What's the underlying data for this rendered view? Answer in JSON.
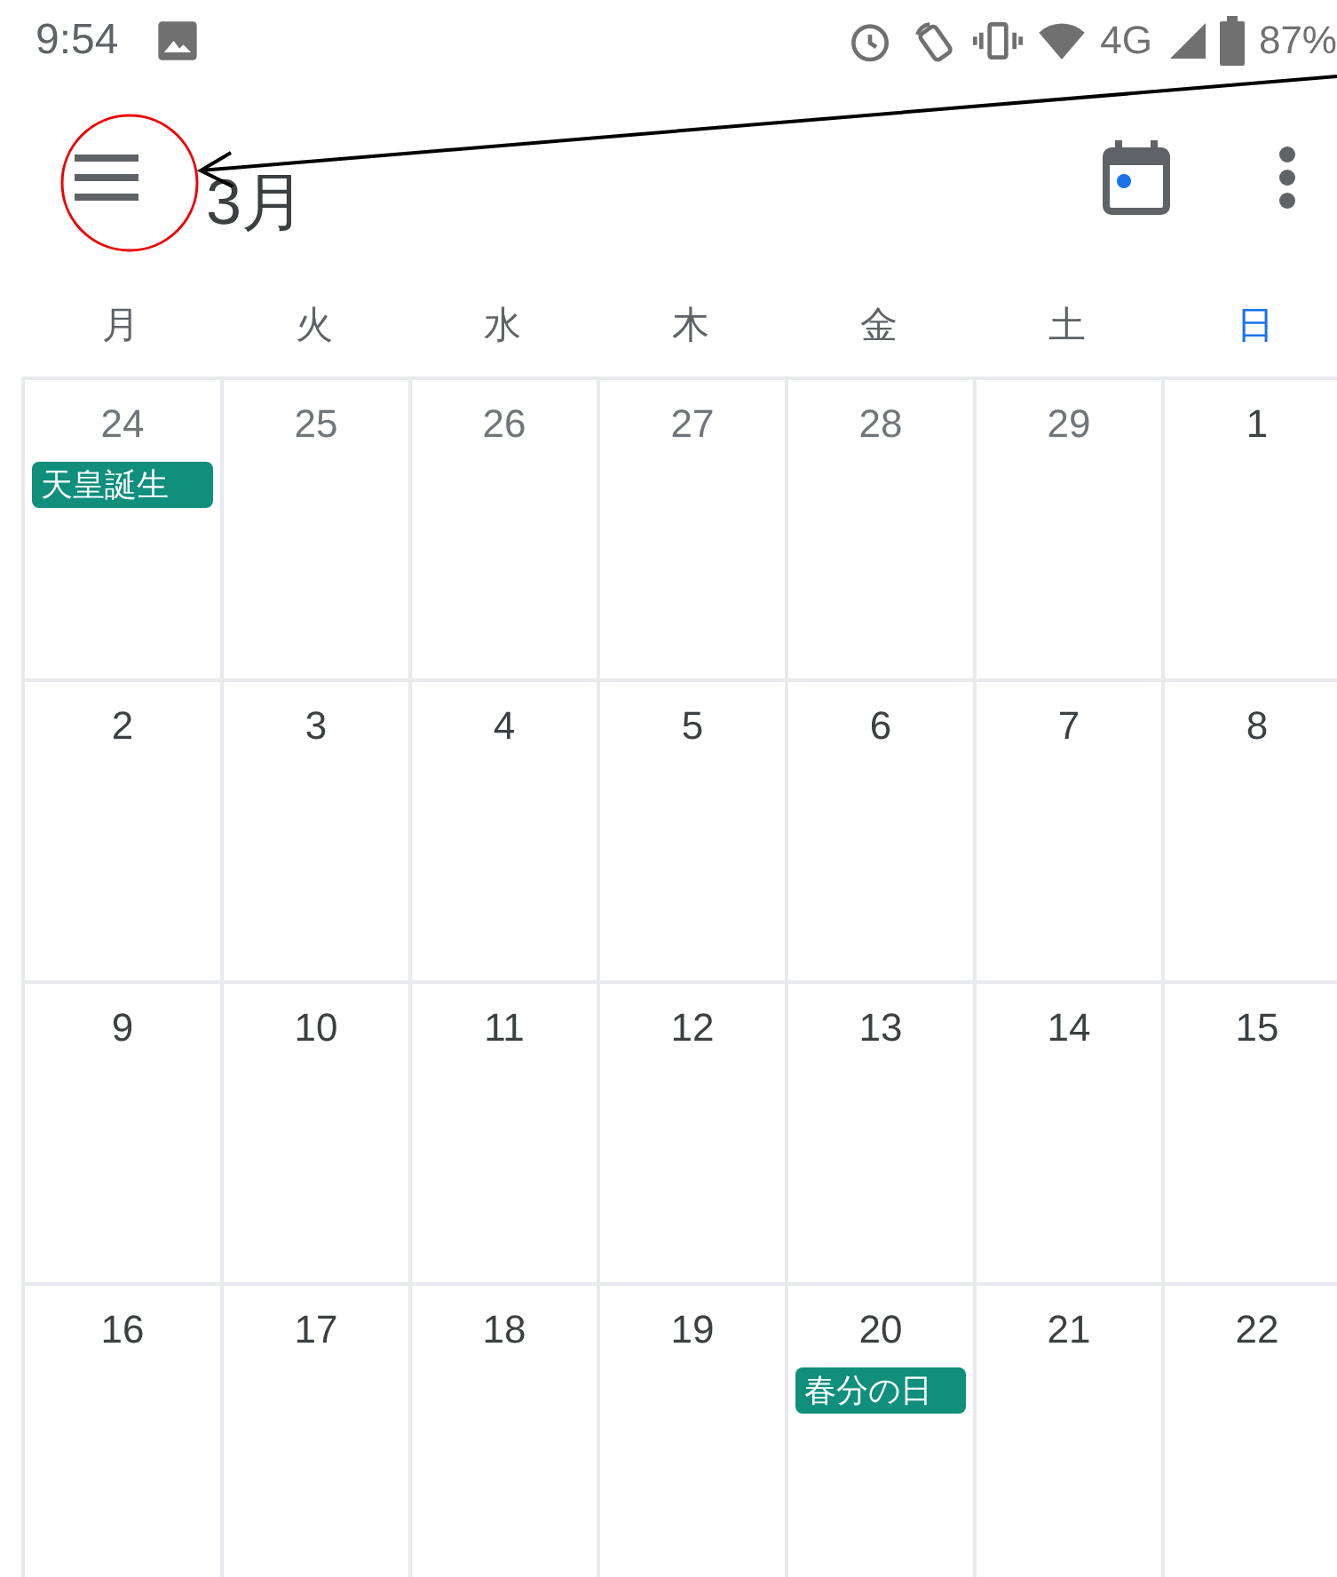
{
  "status_bar": {
    "time": "9:54",
    "network": "4G",
    "battery": "87%"
  },
  "app_bar": {
    "title": "3月"
  },
  "weekdays": [
    {
      "label": "月",
      "today": false
    },
    {
      "label": "火",
      "today": false
    },
    {
      "label": "水",
      "today": false
    },
    {
      "label": "木",
      "today": false
    },
    {
      "label": "金",
      "today": false
    },
    {
      "label": "土",
      "today": false
    },
    {
      "label": "日",
      "today": true
    }
  ],
  "weeks": [
    [
      {
        "day": "24",
        "in_month": false,
        "events": [
          {
            "title": "天皇誕生",
            "color": "#0f8f7c"
          }
        ]
      },
      {
        "day": "25",
        "in_month": false
      },
      {
        "day": "26",
        "in_month": false
      },
      {
        "day": "27",
        "in_month": false
      },
      {
        "day": "28",
        "in_month": false
      },
      {
        "day": "29",
        "in_month": false
      },
      {
        "day": "1",
        "in_month": true
      }
    ],
    [
      {
        "day": "2",
        "in_month": true
      },
      {
        "day": "3",
        "in_month": true
      },
      {
        "day": "4",
        "in_month": true
      },
      {
        "day": "5",
        "in_month": true
      },
      {
        "day": "6",
        "in_month": true
      },
      {
        "day": "7",
        "in_month": true
      },
      {
        "day": "8",
        "in_month": true
      }
    ],
    [
      {
        "day": "9",
        "in_month": true
      },
      {
        "day": "10",
        "in_month": true
      },
      {
        "day": "11",
        "in_month": true
      },
      {
        "day": "12",
        "in_month": true
      },
      {
        "day": "13",
        "in_month": true
      },
      {
        "day": "14",
        "in_month": true
      },
      {
        "day": "15",
        "in_month": true
      }
    ],
    [
      {
        "day": "16",
        "in_month": true
      },
      {
        "day": "17",
        "in_month": true
      },
      {
        "day": "18",
        "in_month": true
      },
      {
        "day": "19",
        "in_month": true
      },
      {
        "day": "20",
        "in_month": true,
        "events": [
          {
            "title": "春分の日",
            "color": "#0f8f7c"
          }
        ]
      },
      {
        "day": "21",
        "in_month": true
      },
      {
        "day": "22",
        "in_month": true
      }
    ]
  ]
}
